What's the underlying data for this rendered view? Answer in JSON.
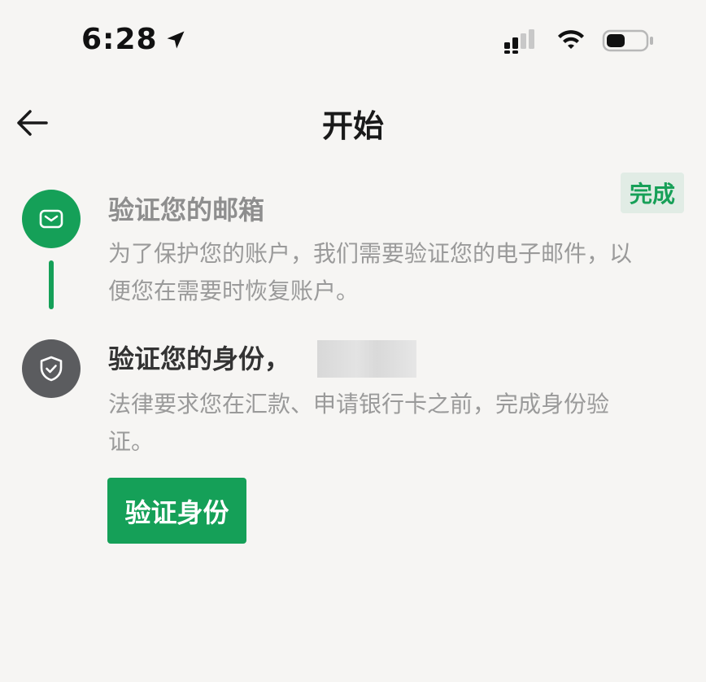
{
  "status_bar": {
    "time": "6:28",
    "icons": [
      "location-arrow-icon",
      "cellular-signal-icon",
      "wifi-icon",
      "battery-icon"
    ]
  },
  "nav": {
    "back_icon": "arrow-left-icon",
    "title": "开始"
  },
  "steps": [
    {
      "icon": "mail-icon",
      "title": "验证您的邮箱",
      "description": "为了保护您的账户，我们需要验证您的电子邮件，以便您在需要时恢复账户。",
      "status": "完成",
      "state": "complete"
    },
    {
      "icon": "shield-check-icon",
      "title": "验证您的身份，",
      "description": "法律要求您在汇款、申请银行卡之前，完成身份验证。",
      "state": "active",
      "action_label": "验证身份"
    }
  ],
  "colors": {
    "accent": "#15a058",
    "background": "#f6f5f3",
    "badge_bg": "#e1ece5",
    "inactive_icon_bg": "#5b5c5f",
    "muted_text": "#9a9a9a"
  }
}
